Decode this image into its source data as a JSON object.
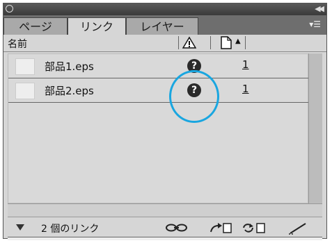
{
  "tabs": [
    {
      "label": "ページ",
      "active": false
    },
    {
      "label": "リンク",
      "active": true
    },
    {
      "label": "レイヤー",
      "active": false
    }
  ],
  "header": {
    "name_label": "名前"
  },
  "links": [
    {
      "name": "部品1.eps",
      "status": "missing",
      "page": "1"
    },
    {
      "name": "部品2.eps",
      "status": "missing",
      "page": "1"
    }
  ],
  "footer": {
    "link_count": "2 個のリンク"
  },
  "icons": {
    "status": "question-icon",
    "warning": "warning-icon",
    "page": "page-icon"
  },
  "colors": {
    "highlight": "#19a6e0",
    "tab_bar": "#6e6e6e",
    "panel": "#d6d6d6"
  }
}
